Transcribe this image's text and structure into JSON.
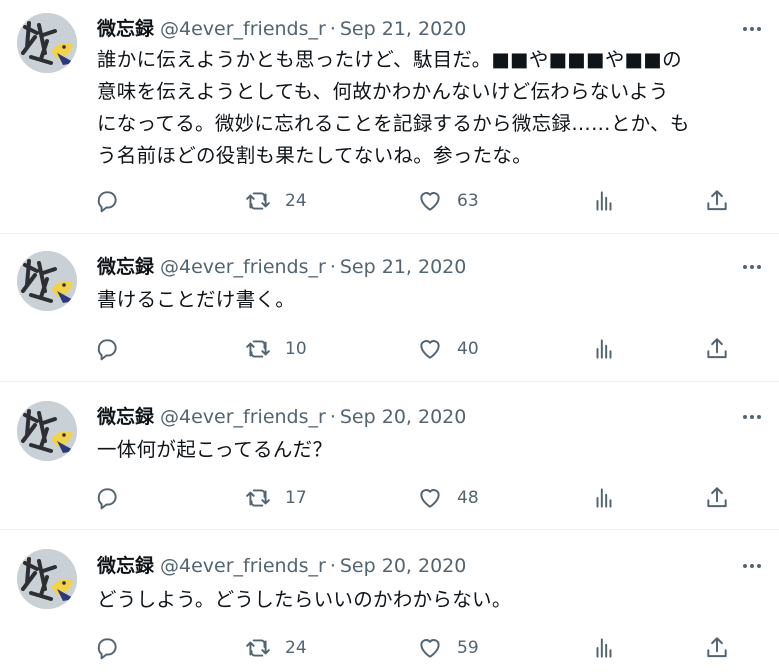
{
  "colors": {
    "text": "#0f1419",
    "secondary": "#536471",
    "divider": "#eff3f4",
    "avatar_ink": "#2d2f33",
    "avatar_bird": "#f2d24b"
  },
  "icons": {
    "reply": "reply-icon",
    "retweet": "retweet-icon",
    "like": "heart-icon",
    "views": "views-icon",
    "share": "share-icon",
    "more": "more-icon"
  },
  "tweets": [
    {
      "name": "微忘録",
      "handle": "@4ever_friends_r",
      "sep": "·",
      "date": "Sep 21, 2020",
      "lines": [
        "誰かに伝えようかとも思ったけど、駄目だ。■■や■■■や■■の",
        "意味を伝えようとしても、何故かわかんないけど伝わらないよう",
        "になってる。微妙に忘れることを記録するから微忘録……とか、も",
        "う名前ほどの役割も果たしてないね。参ったな。"
      ],
      "retweets": "24",
      "likes": "63"
    },
    {
      "name": "微忘録",
      "handle": "@4ever_friends_r",
      "sep": "·",
      "date": "Sep 21, 2020",
      "lines": [
        "書けることだけ書く。"
      ],
      "retweets": "10",
      "likes": "40"
    },
    {
      "name": "微忘録",
      "handle": "@4ever_friends_r",
      "sep": "·",
      "date": "Sep 20, 2020",
      "lines": [
        "一体何が起こってるんだ？"
      ],
      "retweets": "17",
      "likes": "48"
    },
    {
      "name": "微忘録",
      "handle": "@4ever_friends_r",
      "sep": "·",
      "date": "Sep 20, 2020",
      "lines": [
        "どうしよう。どうしたらいいのかわからない。"
      ],
      "retweets": "24",
      "likes": "59"
    }
  ]
}
